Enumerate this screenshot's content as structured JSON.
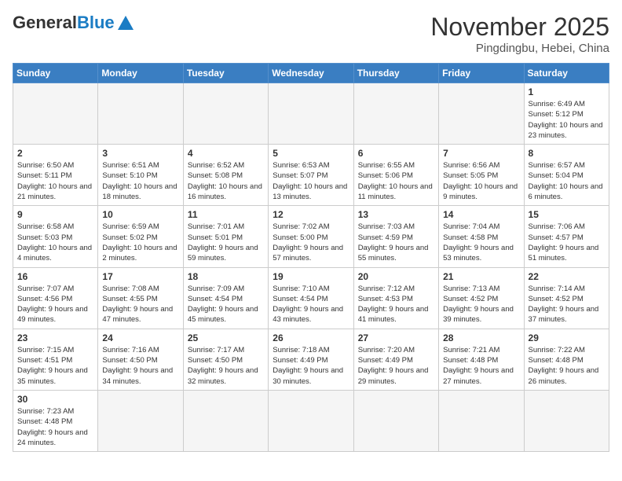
{
  "header": {
    "logo_general": "General",
    "logo_blue": "Blue",
    "month_title": "November 2025",
    "location": "Pingdingbu, Hebei, China"
  },
  "weekdays": [
    "Sunday",
    "Monday",
    "Tuesday",
    "Wednesday",
    "Thursday",
    "Friday",
    "Saturday"
  ],
  "days": [
    {
      "num": "",
      "info": ""
    },
    {
      "num": "",
      "info": ""
    },
    {
      "num": "",
      "info": ""
    },
    {
      "num": "",
      "info": ""
    },
    {
      "num": "",
      "info": ""
    },
    {
      "num": "",
      "info": ""
    },
    {
      "num": "1",
      "info": "Sunrise: 6:49 AM\nSunset: 5:12 PM\nDaylight: 10 hours and 23 minutes."
    },
    {
      "num": "2",
      "info": "Sunrise: 6:50 AM\nSunset: 5:11 PM\nDaylight: 10 hours and 21 minutes."
    },
    {
      "num": "3",
      "info": "Sunrise: 6:51 AM\nSunset: 5:10 PM\nDaylight: 10 hours and 18 minutes."
    },
    {
      "num": "4",
      "info": "Sunrise: 6:52 AM\nSunset: 5:08 PM\nDaylight: 10 hours and 16 minutes."
    },
    {
      "num": "5",
      "info": "Sunrise: 6:53 AM\nSunset: 5:07 PM\nDaylight: 10 hours and 13 minutes."
    },
    {
      "num": "6",
      "info": "Sunrise: 6:55 AM\nSunset: 5:06 PM\nDaylight: 10 hours and 11 minutes."
    },
    {
      "num": "7",
      "info": "Sunrise: 6:56 AM\nSunset: 5:05 PM\nDaylight: 10 hours and 9 minutes."
    },
    {
      "num": "8",
      "info": "Sunrise: 6:57 AM\nSunset: 5:04 PM\nDaylight: 10 hours and 6 minutes."
    },
    {
      "num": "9",
      "info": "Sunrise: 6:58 AM\nSunset: 5:03 PM\nDaylight: 10 hours and 4 minutes."
    },
    {
      "num": "10",
      "info": "Sunrise: 6:59 AM\nSunset: 5:02 PM\nDaylight: 10 hours and 2 minutes."
    },
    {
      "num": "11",
      "info": "Sunrise: 7:01 AM\nSunset: 5:01 PM\nDaylight: 9 hours and 59 minutes."
    },
    {
      "num": "12",
      "info": "Sunrise: 7:02 AM\nSunset: 5:00 PM\nDaylight: 9 hours and 57 minutes."
    },
    {
      "num": "13",
      "info": "Sunrise: 7:03 AM\nSunset: 4:59 PM\nDaylight: 9 hours and 55 minutes."
    },
    {
      "num": "14",
      "info": "Sunrise: 7:04 AM\nSunset: 4:58 PM\nDaylight: 9 hours and 53 minutes."
    },
    {
      "num": "15",
      "info": "Sunrise: 7:06 AM\nSunset: 4:57 PM\nDaylight: 9 hours and 51 minutes."
    },
    {
      "num": "16",
      "info": "Sunrise: 7:07 AM\nSunset: 4:56 PM\nDaylight: 9 hours and 49 minutes."
    },
    {
      "num": "17",
      "info": "Sunrise: 7:08 AM\nSunset: 4:55 PM\nDaylight: 9 hours and 47 minutes."
    },
    {
      "num": "18",
      "info": "Sunrise: 7:09 AM\nSunset: 4:54 PM\nDaylight: 9 hours and 45 minutes."
    },
    {
      "num": "19",
      "info": "Sunrise: 7:10 AM\nSunset: 4:54 PM\nDaylight: 9 hours and 43 minutes."
    },
    {
      "num": "20",
      "info": "Sunrise: 7:12 AM\nSunset: 4:53 PM\nDaylight: 9 hours and 41 minutes."
    },
    {
      "num": "21",
      "info": "Sunrise: 7:13 AM\nSunset: 4:52 PM\nDaylight: 9 hours and 39 minutes."
    },
    {
      "num": "22",
      "info": "Sunrise: 7:14 AM\nSunset: 4:52 PM\nDaylight: 9 hours and 37 minutes."
    },
    {
      "num": "23",
      "info": "Sunrise: 7:15 AM\nSunset: 4:51 PM\nDaylight: 9 hours and 35 minutes."
    },
    {
      "num": "24",
      "info": "Sunrise: 7:16 AM\nSunset: 4:50 PM\nDaylight: 9 hours and 34 minutes."
    },
    {
      "num": "25",
      "info": "Sunrise: 7:17 AM\nSunset: 4:50 PM\nDaylight: 9 hours and 32 minutes."
    },
    {
      "num": "26",
      "info": "Sunrise: 7:18 AM\nSunset: 4:49 PM\nDaylight: 9 hours and 30 minutes."
    },
    {
      "num": "27",
      "info": "Sunrise: 7:20 AM\nSunset: 4:49 PM\nDaylight: 9 hours and 29 minutes."
    },
    {
      "num": "28",
      "info": "Sunrise: 7:21 AM\nSunset: 4:48 PM\nDaylight: 9 hours and 27 minutes."
    },
    {
      "num": "29",
      "info": "Sunrise: 7:22 AM\nSunset: 4:48 PM\nDaylight: 9 hours and 26 minutes."
    },
    {
      "num": "30",
      "info": "Sunrise: 7:23 AM\nSunset: 4:48 PM\nDaylight: 9 hours and 24 minutes."
    },
    {
      "num": "",
      "info": ""
    },
    {
      "num": "",
      "info": ""
    },
    {
      "num": "",
      "info": ""
    },
    {
      "num": "",
      "info": ""
    },
    {
      "num": "",
      "info": ""
    },
    {
      "num": "",
      "info": ""
    }
  ]
}
